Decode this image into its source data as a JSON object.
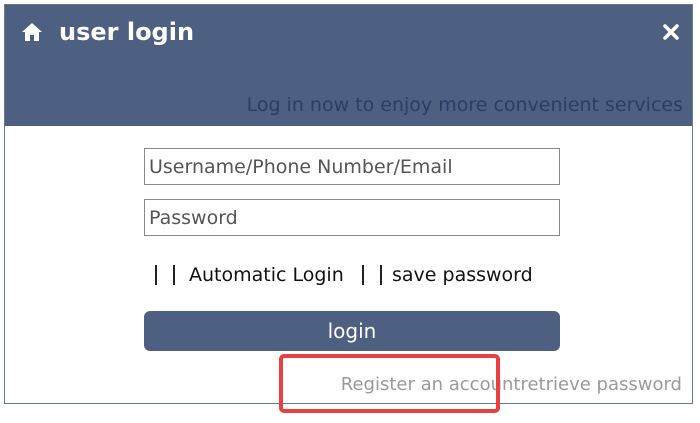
{
  "dialog": {
    "title": "user login",
    "subtitle": "Log in now to enjoy more convenient services",
    "home_icon": "home-icon",
    "close_icon": "close-icon",
    "header_color": "#4e6082"
  },
  "form": {
    "username": {
      "value": "",
      "placeholder": "Username/Phone Number/Email"
    },
    "password": {
      "value": "",
      "placeholder": "Password"
    },
    "auto_login_label": "Automatic Login",
    "save_password_label": "save password",
    "auto_login_checked": false,
    "save_password_checked": false,
    "login_label": "login"
  },
  "links": {
    "register": "Register an account",
    "retrieve": "retrieve password"
  },
  "annotation": {
    "highlight_color": "#e8403f"
  }
}
